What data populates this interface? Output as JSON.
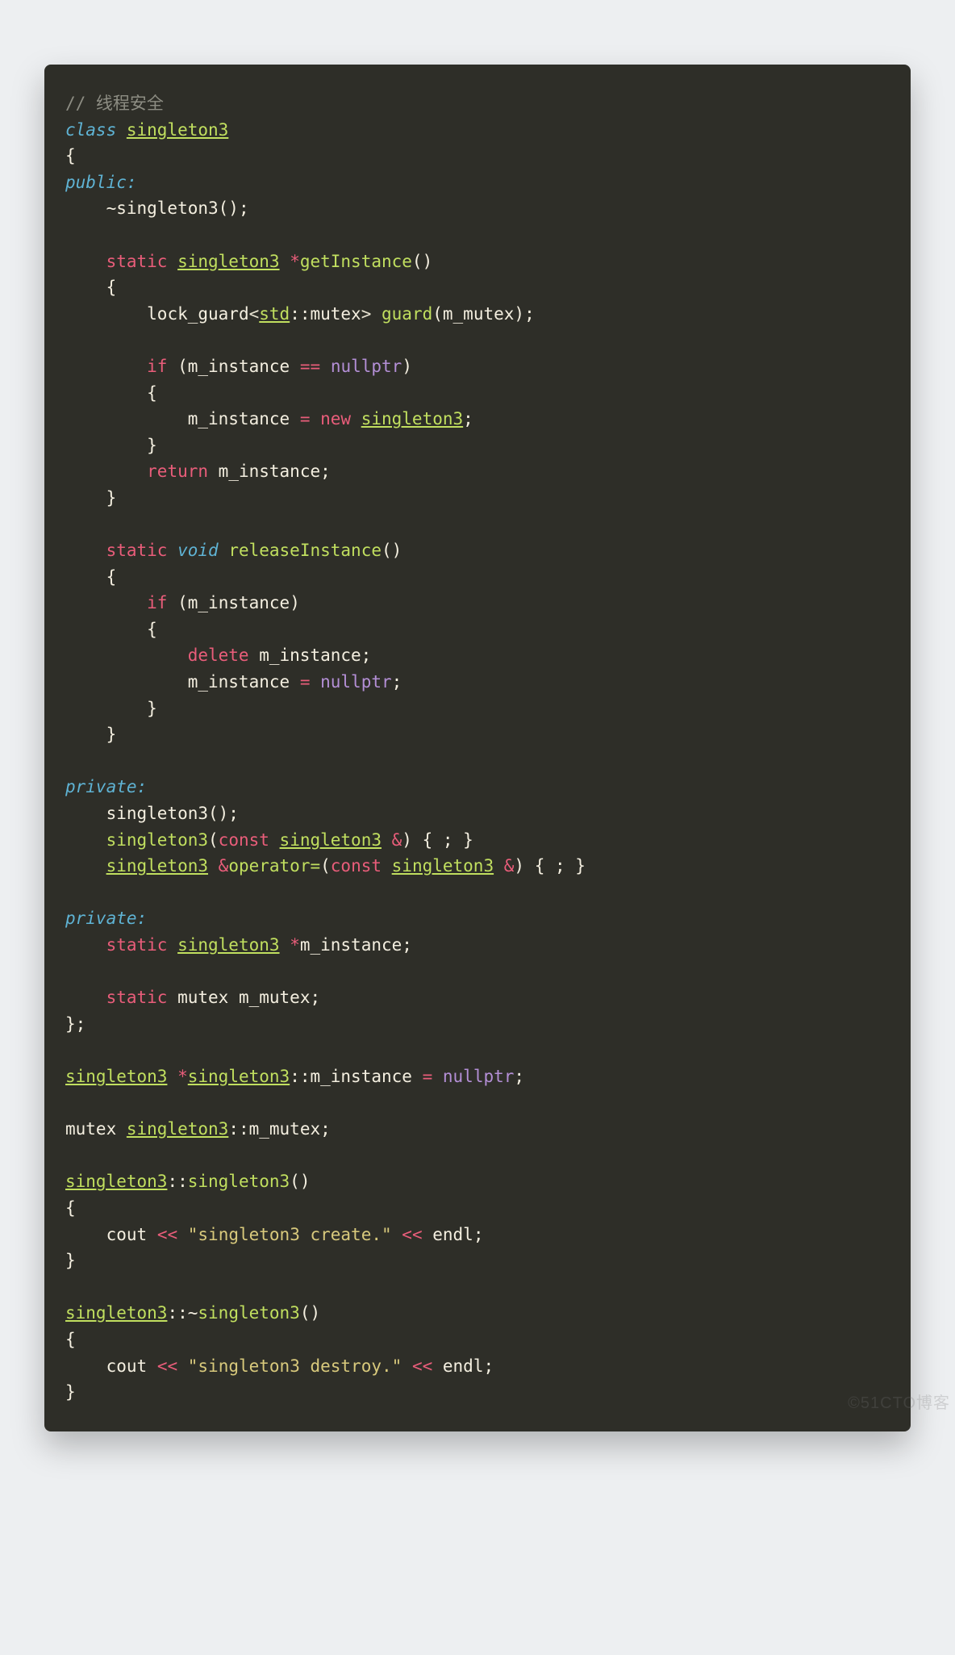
{
  "code": {
    "comment": "// 线程安全",
    "class_kw": "class",
    "class_name": "singleton3",
    "brace_open": "{",
    "public_kw": "public",
    "dtor": "~singleton3();",
    "static_kw": "static",
    "getInstance_name": "getInstance",
    "lock_guard": "lock_guard",
    "std": "std",
    "mutex_t": "mutex",
    "guard_call": "guard",
    "m_mutex": "m_mutex",
    "if_kw": "if",
    "m_instance": "m_instance",
    "eq": "==",
    "nullptr": "nullptr",
    "assign": "=",
    "new_kw": "new",
    "return_kw": "return",
    "void_kw": "void",
    "releaseInstance_name": "releaseInstance",
    "delete_kw": "delete",
    "private_kw": "private",
    "ctor": "singleton3();",
    "copy_ctor_kw": "const",
    "amp": "&",
    "body_empty": "{ ; }",
    "operator_kw": "operator=",
    "star": "*",
    "double_colon": "::",
    "mutex_kw": "mutex",
    "cout": "cout",
    "ins": "<<",
    "str_create": "\"singleton3 create.\"",
    "str_destroy": "\"singleton3 destroy.\"",
    "endl": "endl",
    "colon": ":",
    "semicolon": ";",
    "paren_open": "(",
    "paren_close": ")",
    "brace_close": "}",
    "angle_open": "<",
    "angle_close": ">",
    "close_sc": "};"
  },
  "watermark": "©51CTO博客"
}
